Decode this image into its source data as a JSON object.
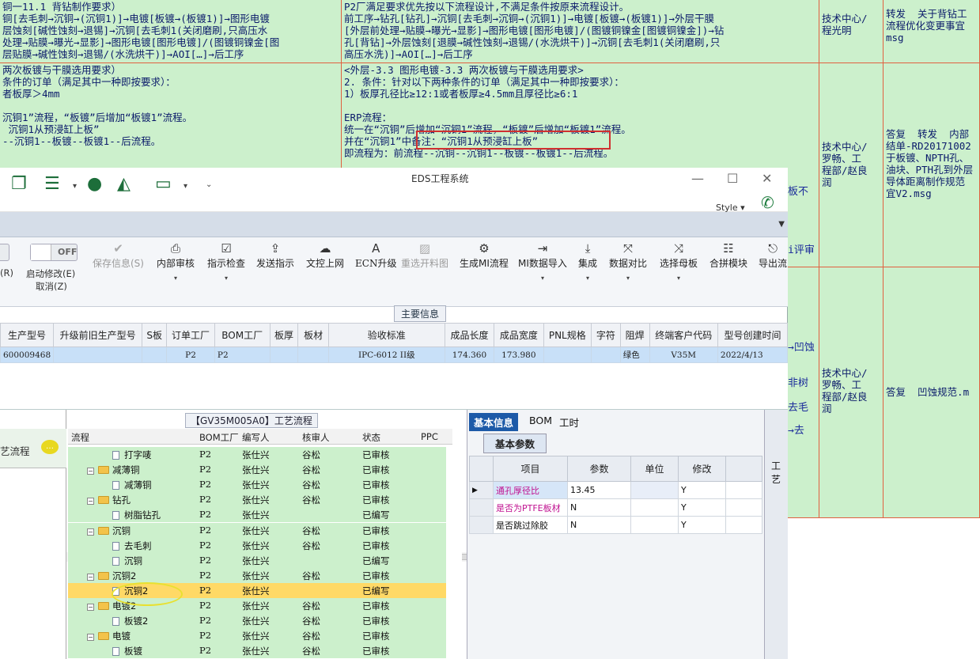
{
  "background_doc": {
    "row1": {
      "col1": "铜一11.1 背钻制作要求）\n铜[去毛刺→沉铜→(沉铜1)]→电镀[板镀→(板镀1)]→图形电镀\n层蚀刻[碱性蚀刻→退锡]→沉铜[去毛刺1(关闭磨刷,只高压水\n处理→贴膜→曝光→显影]→图形电镀[图形电镀]/(图镀铜镍金[图\n层贴膜→碱性蚀刻→退锡/(水洗烘干)]→AOI[…]→后工序",
      "col2": "P2厂满足要求优先按以下流程设计,不满足条件按原来流程设计。\n前工序→钻孔[钻孔]→沉铜[去毛刺→沉铜→(沉铜1)]→电镀[板镀→(板镀1)]→外层干膜\n[外层前处理→贴膜→曝光→显影]→图形电镀[图形电镀]/(图镀铜镍金[图镀铜镍金])→钻\n孔[背钻]→外层蚀刻[退膜→碱性蚀刻→退锡/(水洗烘干)]→沉铜[去毛刺1(关闭磨刷,只\n高压水洗)]→AOI[…]→后工序",
      "col3": "技术中心/\n程光明",
      "col4": "转发  关于背钻工\n流程优化变更事宜\nmsg"
    },
    "row2": {
      "col1": "两次板镀与干膜选用要求）\n条件的订单（满足其中一种即按要求）：\n者板厚＞4mm\n\n沉铜1”流程，“板镀”后增加“板镀1”流程。\n 沉铜1从预浸缸上板”\n--沉铜1--板镀--板镀1--后流程。",
      "col2": "<外层-3.3 图形电镀-3.3 两次板镀与干膜选用要求>\n2. 条件：针对以下两种条件的订单（满足其中一种即按要求）：\n1）板厚孔径比≥12:1或者板厚≥4.5mm且厚径比≥6:1\n\nERP流程：\n统一在“沉铜”后增加“沉铜1”流程，“板镀”后增加“板镀1”流程。\n并在“沉铜1”中备注：“沉铜1从预浸缸上板”\n即流程为：前流程--沉铜--沉铜1--板镀--板镀1--后流程。",
      "col2_frag1": "板不",
      "col2_frag2": "i评审",
      "col3": "技术中心/\n罗畅、工\n程部/赵良\n润",
      "col4": "答复  转发  内部\n结单-RD20171002\n于板镀、NPTH孔、\n油块、PTH孔到外层\n导体距离制作规范\n宜V2.msg"
    },
    "row3": {
      "frag1": "→凹蚀",
      "frag2": "非树",
      "frag3": "去毛",
      "frag4": "→去",
      "col3": "技术中心/\n罗畅、工\n程部/赵良\n润",
      "col4": "答复  凹蚀规范.m"
    }
  },
  "window": {
    "title": "EDS工程系统",
    "style_label": "Style",
    "toggle_left": "F",
    "toggle_off": "OFF",
    "ribbon": {
      "r_label": "(R)",
      "start_modify": "启动修改(E)",
      "cancel": "取消(Z)",
      "buttons": [
        {
          "label": "保存信息(S)"
        },
        {
          "label": "内部审核"
        },
        {
          "label": "指示检查"
        },
        {
          "label": "发送指示"
        },
        {
          "label": "文控上网"
        },
        {
          "label": "ECN升级"
        },
        {
          "label": "重选开料图"
        },
        {
          "label": "生成MI流程"
        },
        {
          "label": "MI数据导入"
        },
        {
          "label": "集成"
        },
        {
          "label": "数据对比"
        },
        {
          "label": "选择母板"
        },
        {
          "label": "合拼模块"
        },
        {
          "label": "导出流"
        }
      ]
    },
    "main_info_title": "主要信息",
    "grid": {
      "headers": [
        "生产型号",
        "升级前旧生产型号",
        "S板",
        "订单工厂",
        "BOM工厂",
        "板厚",
        "板材",
        "验收标准",
        "成品长度",
        "成品宽度",
        "PNL规格",
        "字符",
        "阻焊",
        "终端客户代码",
        "型号创建时间"
      ],
      "row": [
        "600009468",
        "",
        "",
        "P2",
        "P2",
        "",
        "",
        "IPC-6012 II级",
        "174.360",
        "173.980",
        "",
        "",
        "绿色",
        "V35M",
        "2022/4/13"
      ]
    },
    "left_panel_label": "艺流程",
    "tree": {
      "title": "【GV35M005A0】工艺流程",
      "headers": {
        "flow": "流程",
        "bom": "BOM工厂",
        "author": "编写人",
        "reviewer": "核审人",
        "status": "状态",
        "ppc": "PPC"
      },
      "rows": [
        {
          "name": "打字唛",
          "bom": "P2",
          "author": "张仕兴",
          "reviewer": "谷松",
          "status": "已审核"
        },
        {
          "name": "减薄铜",
          "bom": "P2",
          "author": "张仕兴",
          "reviewer": "谷松",
          "status": "已审核"
        },
        {
          "name": "减薄铜",
          "bom": "P2",
          "author": "张仕兴",
          "reviewer": "谷松",
          "status": "已审核"
        },
        {
          "name": "钻孔",
          "bom": "P2",
          "author": "张仕兴",
          "reviewer": "谷松",
          "status": "已审核"
        },
        {
          "name": "树脂钻孔",
          "bom": "P2",
          "author": "张仕兴",
          "reviewer": "",
          "status": "已编写"
        },
        {
          "name": "沉铜",
          "bom": "P2",
          "author": "张仕兴",
          "reviewer": "谷松",
          "status": "已审核"
        },
        {
          "name": "去毛刺",
          "bom": "P2",
          "author": "张仕兴",
          "reviewer": "谷松",
          "status": "已审核"
        },
        {
          "name": "沉铜",
          "bom": "P2",
          "author": "张仕兴",
          "reviewer": "",
          "status": "已编写"
        },
        {
          "name": "沉铜2",
          "bom": "P2",
          "author": "张仕兴",
          "reviewer": "谷松",
          "status": "已审核"
        },
        {
          "name": "沉铜2",
          "bom": "P2",
          "author": "张仕兴",
          "reviewer": "",
          "status": "已编写"
        },
        {
          "name": "电镀2",
          "bom": "P2",
          "author": "张仕兴",
          "reviewer": "谷松",
          "status": "已审核"
        },
        {
          "name": "板镀2",
          "bom": "P2",
          "author": "张仕兴",
          "reviewer": "谷松",
          "status": "已审核"
        },
        {
          "name": "电镀",
          "bom": "P2",
          "author": "张仕兴",
          "reviewer": "谷松",
          "status": "已审核"
        },
        {
          "name": "板镀",
          "bom": "P2",
          "author": "张仕兴",
          "reviewer": "谷松",
          "status": "已审核"
        }
      ]
    },
    "right": {
      "tabs": [
        "基本信息",
        "BOM",
        "工时"
      ],
      "subtab": "基本参数",
      "headers": {
        "item": "项目",
        "param": "参数",
        "unit": "单位",
        "modify": "修改"
      },
      "rows": [
        {
          "item": "通孔厚径比",
          "param": "13.45",
          "unit": "",
          "modify": "Y"
        },
        {
          "item": "是否为PTFE板材",
          "param": "N",
          "unit": "",
          "modify": "Y"
        },
        {
          "item": "是否跳过除胶",
          "param": "N",
          "unit": "",
          "modify": "Y"
        }
      ],
      "side_label": "工艺"
    }
  }
}
